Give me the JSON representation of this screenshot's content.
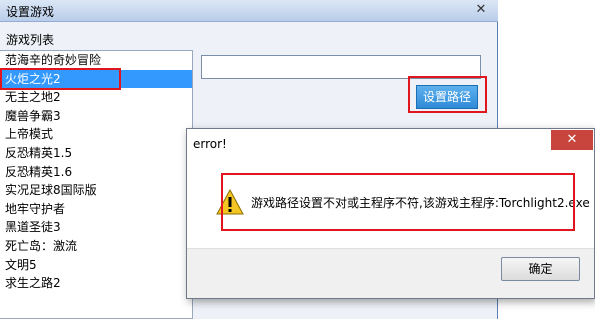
{
  "window": {
    "title": "设置游戏",
    "close_glyph": "✕"
  },
  "game_list": {
    "label": "游戏列表",
    "selected_index": 1,
    "items": [
      "范海辛的奇妙冒险",
      "火炬之光2",
      "无主之地2",
      "魔兽争霸3",
      "上帝模式",
      "反恐精英1.5",
      "反恐精英1.6",
      "实况足球8国际版",
      "地牢守护者",
      "黑道圣徒3",
      "死亡岛：激流",
      "文明5",
      "求生之路2"
    ]
  },
  "path": {
    "value": "",
    "placeholder": ""
  },
  "set_path_button": {
    "label": "设置路径"
  },
  "error_dialog": {
    "title": "error!",
    "close_glyph": "✕",
    "message": "游戏路径设置不对或主程序不符,该游戏主程序:Torchlight2.exe",
    "ok_label": "确定"
  },
  "colors": {
    "annotation": "#e0161f",
    "selection": "#3399ff",
    "button_blue": "#2e8ad8",
    "dialog_close": "#c7453c"
  },
  "icons": {
    "warning": "warning-icon",
    "close": "close-icon"
  }
}
